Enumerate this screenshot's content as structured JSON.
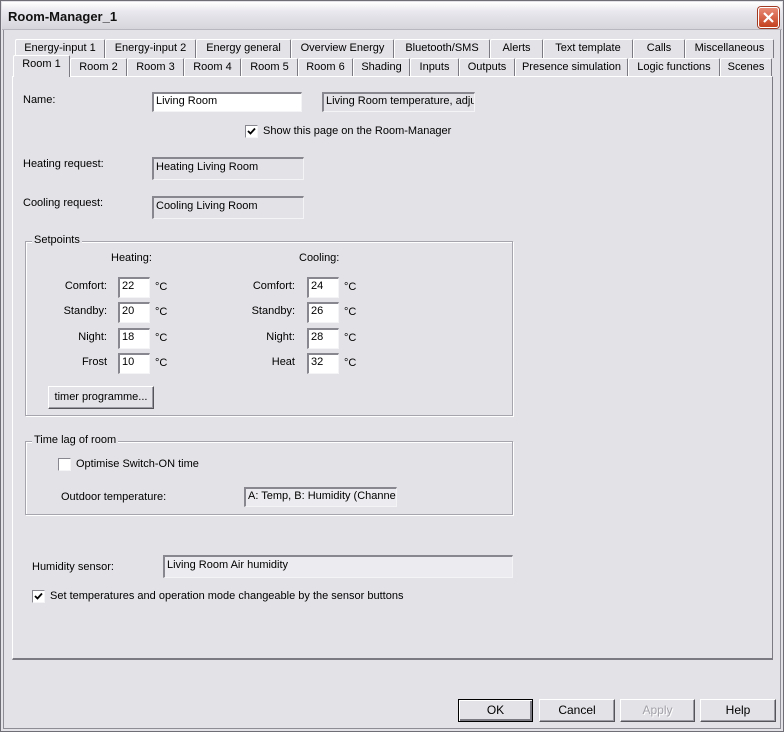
{
  "window": {
    "title": "Room-Manager_1",
    "close_icon": "close-x-icon"
  },
  "tabs": {
    "row_back": [
      {
        "label": "Energy-input 1"
      },
      {
        "label": "Energy-input 2"
      },
      {
        "label": "Energy general"
      },
      {
        "label": "Overview Energy"
      },
      {
        "label": "Bluetooth/SMS"
      },
      {
        "label": "Alerts"
      },
      {
        "label": "Text template"
      },
      {
        "label": "Calls"
      },
      {
        "label": "Miscellaneous"
      }
    ],
    "row_front": [
      {
        "label": "Room 1",
        "active": true
      },
      {
        "label": "Room 2"
      },
      {
        "label": "Room 3"
      },
      {
        "label": "Room 4"
      },
      {
        "label": "Room 5"
      },
      {
        "label": "Room 6"
      },
      {
        "label": "Shading"
      },
      {
        "label": "Inputs"
      },
      {
        "label": "Outputs"
      },
      {
        "label": "Presence simulation"
      },
      {
        "label": "Logic functions"
      },
      {
        "label": "Scenes"
      }
    ]
  },
  "room": {
    "name_label": "Name:",
    "name_value": "Living Room",
    "name_description": "Living Room  temperature, adju",
    "show_page_label": "Show this page on the Room-Manager",
    "show_page_checked": true,
    "heating_request_label": "Heating request:",
    "heating_request_value": "Heating Living Room",
    "cooling_request_label": "Cooling request:",
    "cooling_request_value": "Cooling Living Room"
  },
  "setpoints": {
    "title": "Setpoints",
    "heating_header": "Heating:",
    "cooling_header": "Cooling:",
    "unit": "°C",
    "heating": [
      {
        "label": "Comfort:",
        "value": "22"
      },
      {
        "label": "Standby:",
        "value": "20"
      },
      {
        "label": "Night:",
        "value": "18"
      },
      {
        "label": "Frost",
        "value": "10"
      }
    ],
    "cooling": [
      {
        "label": "Comfort:",
        "value": "24"
      },
      {
        "label": "Standby:",
        "value": "26"
      },
      {
        "label": "Night:",
        "value": "28"
      },
      {
        "label": "Heat",
        "value": "32"
      }
    ],
    "timer_button": "timer programme..."
  },
  "time_lag": {
    "title": "Time lag of room",
    "optimise_label": "Optimise Switch-ON time",
    "optimise_checked": false,
    "outdoor_label": "Outdoor temperature:",
    "outdoor_value": "A: Temp, B: Humidity  (Channel"
  },
  "humidity": {
    "label": "Humidity sensor:",
    "value": "Living Room  Air humidity"
  },
  "sensor_buttons": {
    "label": "Set temperatures and operation mode changeable by the sensor buttons",
    "checked": true
  },
  "footer": {
    "ok": "OK",
    "cancel": "Cancel",
    "apply": "Apply",
    "help": "Help"
  }
}
